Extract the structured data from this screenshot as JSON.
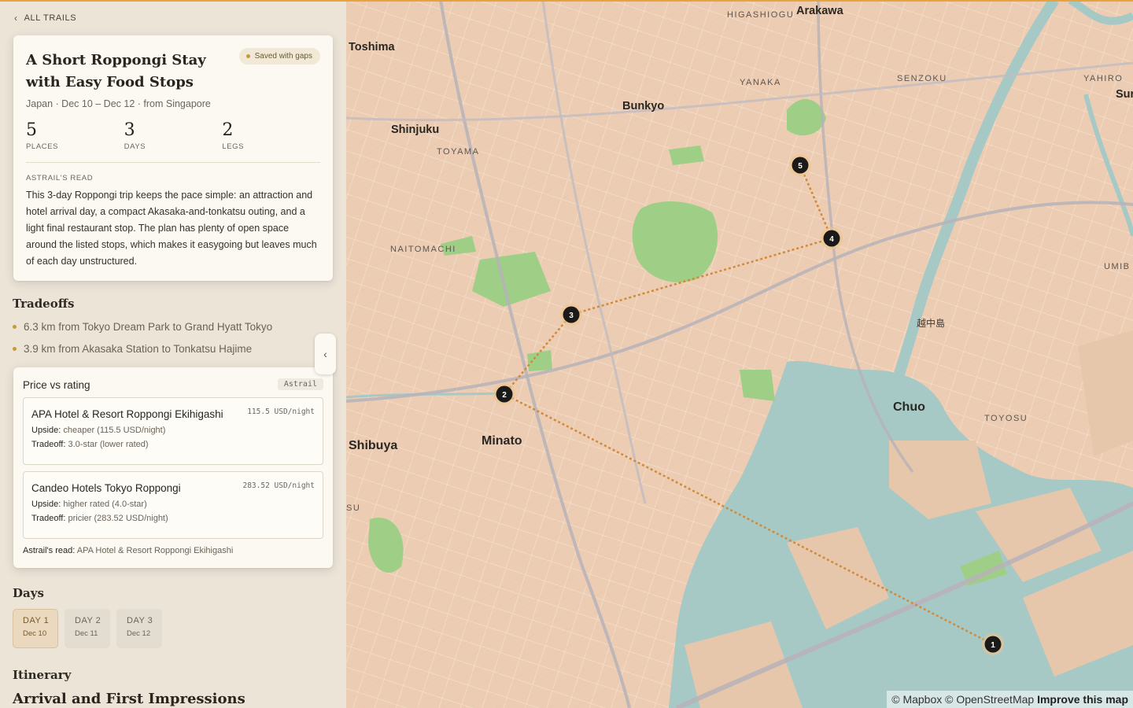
{
  "nav": {
    "back_label": "ALL TRAILS"
  },
  "trip": {
    "title": "A Short Roppongi Stay with Easy Food Stops",
    "badge": "Saved with gaps",
    "subline": "Japan · Dec 10 – Dec 12 · from Singapore",
    "stats": [
      {
        "value": "5",
        "label": "PLACES"
      },
      {
        "value": "3",
        "label": "DAYS"
      },
      {
        "value": "2",
        "label": "LEGS"
      }
    ],
    "read_label": "ASTRAIL'S READ",
    "read_text": "This 3-day Roppongi trip keeps the pace simple: an attraction and hotel arrival day, a compact Akasaka-and-tonkatsu outing, and a light final restaurant stop. The plan has plenty of open space around the listed stops, which makes it easygoing but leaves much of each day unstructured."
  },
  "tradeoffs": {
    "heading": "Tradeoffs",
    "items": [
      "6.3 km from Tokyo Dream Park to Grand Hyatt Tokyo",
      "3.9 km from Akasaka Station to Tonkatsu Hajime"
    ]
  },
  "price_vs_rating": {
    "title": "Price vs rating",
    "source": "Astrail",
    "hotels": [
      {
        "name": "APA Hotel & Resort Roppongi Ekihigashi",
        "price": "115.5 USD/night",
        "upside_label": "Upside:",
        "upside": "cheaper (115.5 USD/night)",
        "tradeoff_label": "Tradeoff:",
        "tradeoff": "3.0-star (lower rated)"
      },
      {
        "name": "Candeo Hotels Tokyo Roppongi",
        "price": "283.52 USD/night",
        "upside_label": "Upside:",
        "upside": "higher rated (4.0-star)",
        "tradeoff_label": "Tradeoff:",
        "tradeoff": "pricier (283.52 USD/night)"
      }
    ],
    "read_label": "Astrail's read:",
    "read_value": "APA Hotel & Resort Roppongi Ekihigashi"
  },
  "days": {
    "heading": "Days",
    "items": [
      {
        "label": "DAY 1",
        "date": "Dec 10",
        "active": true
      },
      {
        "label": "DAY 2",
        "date": "Dec 11",
        "active": false
      },
      {
        "label": "DAY 3",
        "date": "Dec 12",
        "active": false
      }
    ]
  },
  "itinerary": {
    "heading": "Itinerary",
    "first_title": "Arrival and First Impressions"
  },
  "map": {
    "labels": {
      "higashiogu": "HIGASHIOGU",
      "arakawa": "Arakawa",
      "toshima": "Toshima",
      "yanaka": "YANAKA",
      "senzoku": "SENZOKU",
      "yahiro": "YAHIRO",
      "sur": "Sur",
      "bunkyo": "Bunkyo",
      "shinjuku": "Shinjuku",
      "toyama": "TOYAMA",
      "naitomachi": "NAITOMACHI",
      "umib": "UMIB",
      "etchujima": "越中島",
      "chuo": "Chuo",
      "toyosu": "TOYOSU",
      "shibuya": "Shibuya",
      "minato": "Minato",
      "su": "SU"
    },
    "markers": [
      "1",
      "2",
      "3",
      "4",
      "5"
    ],
    "attribution": {
      "mapbox": "© Mapbox",
      "osm": "© OpenStreetMap",
      "improve": "Improve this map"
    },
    "colors": {
      "land": "#eccdb3",
      "water": "#a7c9c6",
      "park": "#9fcf86",
      "route": "#d08a3a",
      "marker": "#1c1a18"
    }
  }
}
